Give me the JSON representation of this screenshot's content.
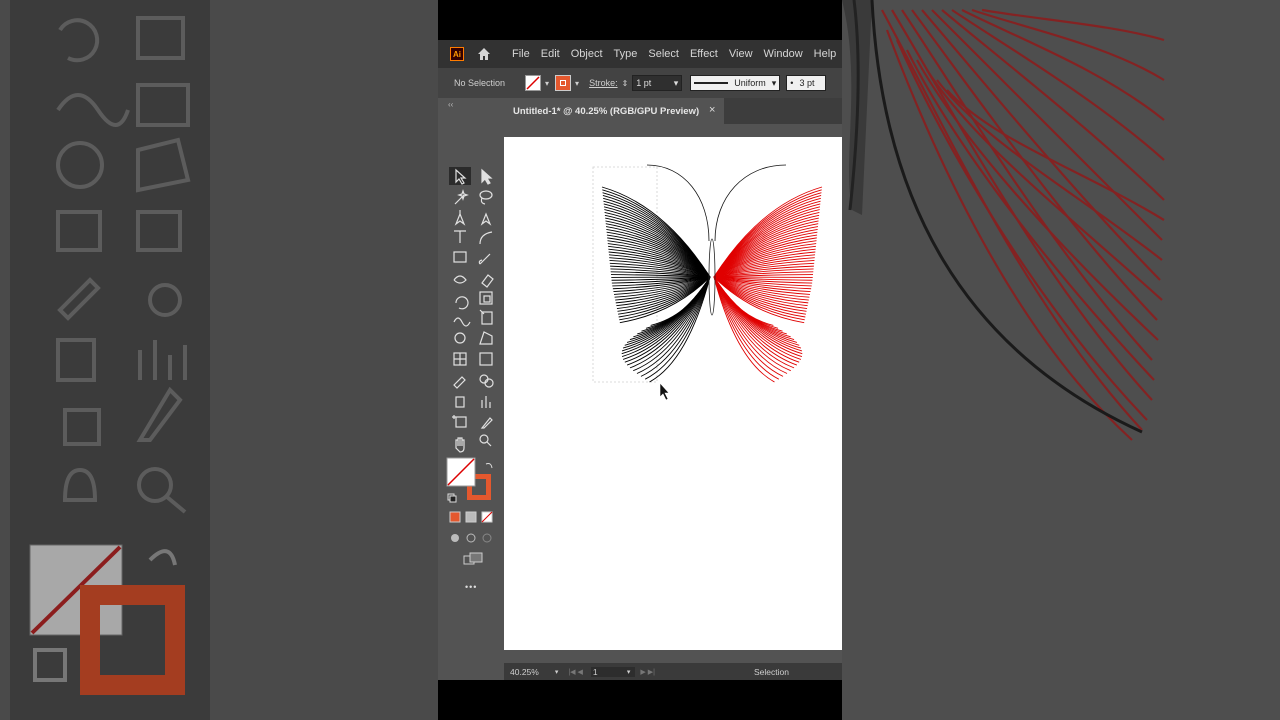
{
  "app": {
    "logo_text": "Ai"
  },
  "menu": [
    "File",
    "Edit",
    "Object",
    "Type",
    "Select",
    "Effect",
    "View",
    "Window",
    "Help"
  ],
  "control": {
    "selection_label": "No Selection",
    "stroke_label": "Stroke:",
    "stroke_weight": "1 pt",
    "stroke_profile": "Uniform",
    "brush_size": "3 pt"
  },
  "document": {
    "tab_title": "Untitled-1* @ 40.25% (RGB/GPU Preview)",
    "close_glyph": "×"
  },
  "status": {
    "zoom": "40.25%",
    "page": "1",
    "mode": "Selection"
  },
  "colors": {
    "accent": "#e4582e",
    "wing_left": "#000000",
    "wing_right": "#e00000",
    "ui_dark": "#323232",
    "ui_mid": "#535353"
  },
  "toolbar": {
    "more_glyph": "•••"
  }
}
